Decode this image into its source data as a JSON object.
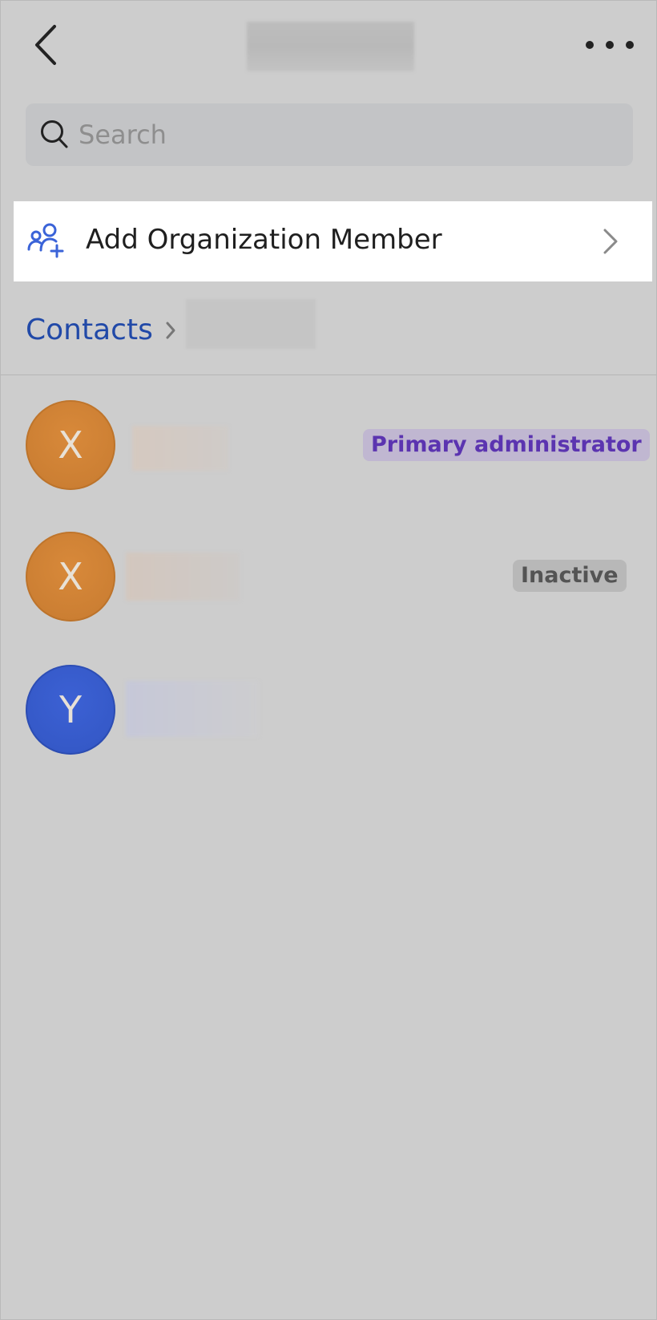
{
  "header": {
    "back_icon": "chevron-left-icon",
    "more_icon": "more-horizontal-icon"
  },
  "search": {
    "placeholder": "Search",
    "value": "",
    "icon": "search-icon"
  },
  "add_member": {
    "label": "Add Organization Member",
    "icon": "add-user-group-icon",
    "chevron_icon": "chevron-right-icon"
  },
  "breadcrumb": {
    "root_label": "Contacts",
    "separator_icon": "chevron-right-icon"
  },
  "members": [
    {
      "initial": "X",
      "avatar_color": "#cc7f33",
      "badge": "Primary administrator",
      "badge_color": "#5b34b0"
    },
    {
      "initial": "X",
      "avatar_color": "#cc7f33",
      "badge": "Inactive",
      "badge_color": "#545454"
    },
    {
      "initial": "Y",
      "avatar_color": "#3559c8",
      "badge": ""
    }
  ],
  "colors": {
    "accent_blue": "#2149a8",
    "icon_blue": "#3a63d8",
    "overlay_background": "#cdcdcd"
  }
}
